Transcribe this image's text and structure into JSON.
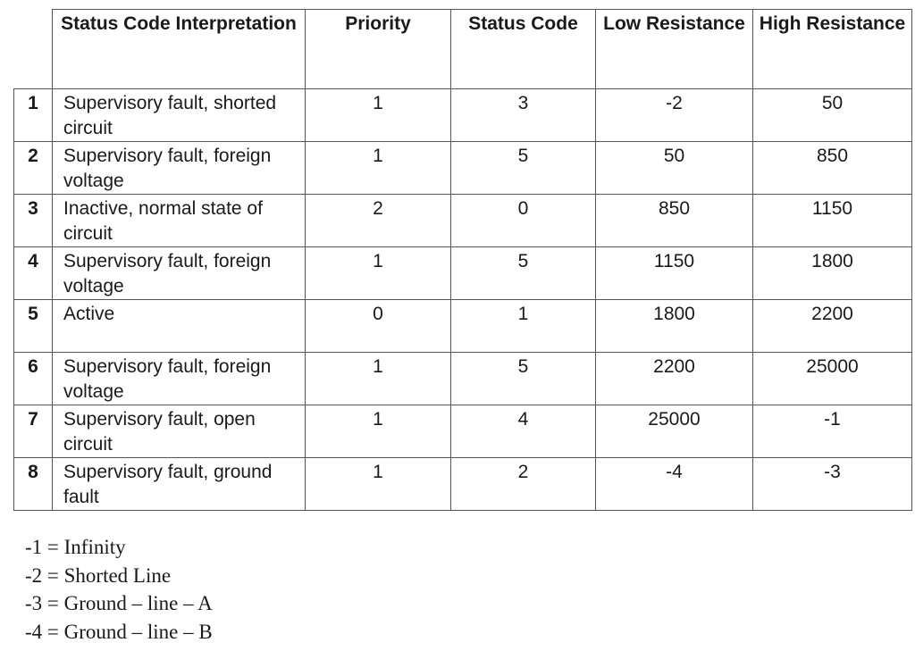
{
  "table": {
    "headers": {
      "interpretation": "Status Code Interpretation",
      "priority": "Priority",
      "status_code": "Status Code",
      "low_resistance": "Low Resistance",
      "high_resistance": "High Resistance"
    },
    "rows": [
      {
        "num": "1",
        "interpretation": "Supervisory fault, shorted circuit",
        "priority": "1",
        "status_code": "3",
        "low": "-2",
        "high": "50"
      },
      {
        "num": "2",
        "interpretation": "Supervisory fault, foreign voltage",
        "priority": "1",
        "status_code": "5",
        "low": "50",
        "high": "850"
      },
      {
        "num": "3",
        "interpretation": "Inactive, normal state of circuit",
        "priority": "2",
        "status_code": "0",
        "low": "850",
        "high": "1150"
      },
      {
        "num": "4",
        "interpretation": "Supervisory fault, foreign voltage",
        "priority": "1",
        "status_code": "5",
        "low": "1150",
        "high": "1800"
      },
      {
        "num": "5",
        "interpretation": "Active",
        "priority": "0",
        "status_code": "1",
        "low": "1800",
        "high": "2200"
      },
      {
        "num": "6",
        "interpretation": "Supervisory fault, foreign voltage",
        "priority": "1",
        "status_code": "5",
        "low": "2200",
        "high": "25000"
      },
      {
        "num": "7",
        "interpretation": "Supervisory fault, open circuit",
        "priority": "1",
        "status_code": "4",
        "low": "25000",
        "high": "-1"
      },
      {
        "num": "8",
        "interpretation": "Supervisory fault, ground fault",
        "priority": "1",
        "status_code": "2",
        "low": "-4",
        "high": "-3"
      }
    ]
  },
  "legend": [
    "-1 = Infinity",
    "-2 = Shorted Line",
    "-3 = Ground – line – A",
    "-4 = Ground – line – B"
  ]
}
